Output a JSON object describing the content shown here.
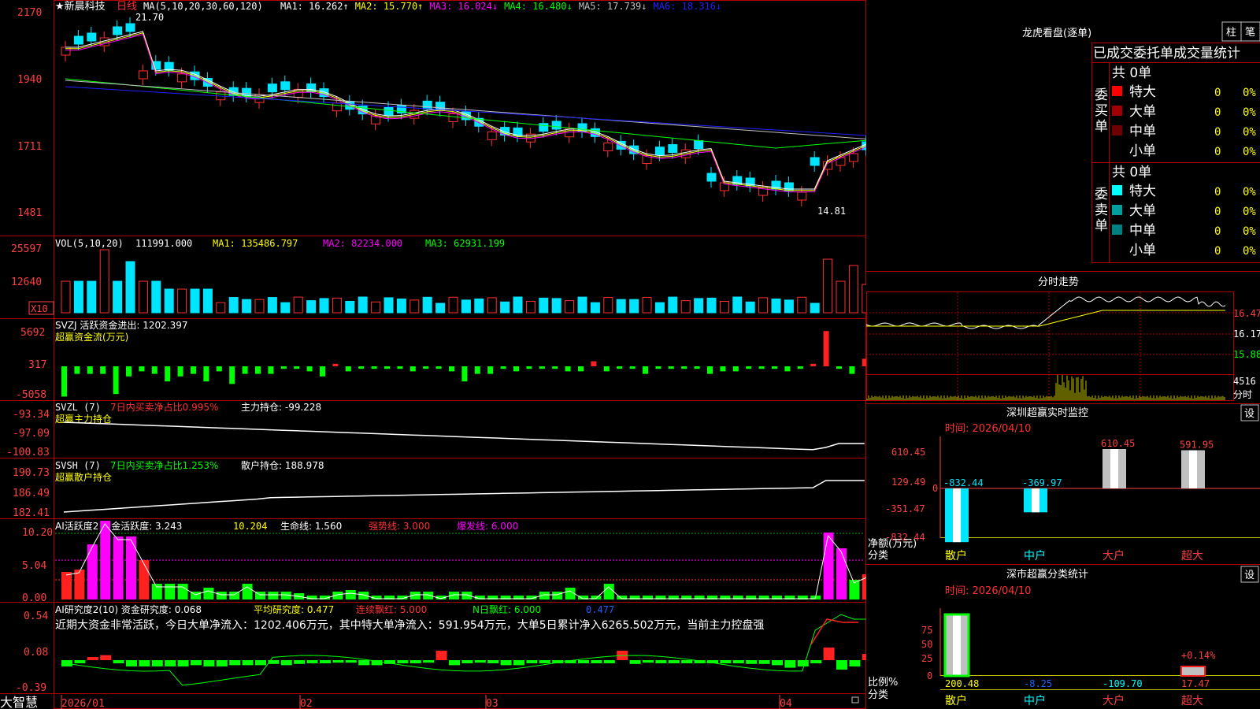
{
  "stock_name": "★新晨科技",
  "period": "日线",
  "ma_header": {
    "prefix": "MA(5,10,20,30,60,120)",
    "items": [
      {
        "label": "MA1: 16.262",
        "color": "#ffffff",
        "arrow": "↑"
      },
      {
        "label": "MA2: 15.770",
        "color": "#ffff00",
        "arrow": "↑"
      },
      {
        "label": "MA3: 16.024",
        "color": "#ff00ff",
        "arrow": "↓"
      },
      {
        "label": "MA4: 16.480",
        "color": "#00ff00",
        "arrow": "↓"
      },
      {
        "label": "MA5: 17.739",
        "color": "#c0c0c0",
        "arrow": "↓"
      },
      {
        "label": "MA6: 18.316",
        "color": "#2020ff",
        "arrow": "↓"
      }
    ]
  },
  "price_axis": [
    "2170",
    "1940",
    "1711",
    "1481"
  ],
  "price_high_label": "21.70",
  "price_low_label": "14.81",
  "vol_header": {
    "prefix": "VOL(5,10,20)",
    "value": "111991.000",
    "ma1": "MA1: 135486.797",
    "ma2": "MA2: 82234.000",
    "ma3": "MA3: 62931.199"
  },
  "vol_axis": [
    "25597",
    "12640"
  ],
  "vol_unit": "X10",
  "svzj": {
    "title": "SVZJ  活跃资金进出: 1202.397",
    "subtitle": "超赢资金流(万元)",
    "axis": [
      "5692",
      "317",
      "-5058"
    ],
    "values": [
      -12,
      -3,
      -3,
      -3,
      -11,
      -4,
      -2,
      -3,
      -6,
      -4,
      -3,
      -6,
      -2,
      -7,
      -3,
      -3,
      -3,
      -1,
      -1,
      -2,
      -4,
      1,
      -2,
      -1,
      -1,
      -1,
      -1,
      -2,
      -1,
      -1,
      -2,
      -6,
      -3,
      -3,
      -1,
      -2,
      -1,
      -1,
      -1,
      -2,
      -2,
      2,
      -2,
      -1,
      -1,
      -3,
      -1,
      -1,
      -1,
      -1,
      -3,
      -2,
      -2,
      -1,
      -1,
      -1,
      -2,
      -1,
      1,
      14,
      -1,
      -3,
      3
    ]
  },
  "svzl": {
    "title_a": "SVZL (7)",
    "title_b": "7日内买卖净占比0.995%",
    "title_c": "主力持仓: -99.228",
    "subtitle": "超赢主力持仓",
    "axis": [
      "-93.34",
      "-97.09",
      "-100.83"
    ]
  },
  "svsh": {
    "title_a": "SVSH (7)",
    "title_b": "7日内买卖净占比1.253%",
    "title_c": "散户持仓: 188.978",
    "subtitle": "超赢散户持仓",
    "axis": [
      "190.73",
      "186.49",
      "182.41"
    ]
  },
  "ai_active": {
    "title": "AI活跃度2 资金活跃度: 3.243",
    "v2": "10.204",
    "life": "生命线: 1.560",
    "strong": "强势线: 3.000",
    "burst": "爆发线: 6.000",
    "axis": [
      "10.20",
      "5.04",
      "0.00"
    ],
    "values": [
      3.5,
      3.8,
      7,
      10,
      8,
      8,
      5,
      2,
      2,
      2,
      1,
      1.5,
      1,
      1,
      2,
      1,
      1,
      1,
      0.8,
      0.5,
      0.5,
      1,
      1.2,
      1,
      0.5,
      0.5,
      0.5,
      1,
      1,
      0.5,
      1,
      1,
      0.5,
      0.5,
      0.5,
      0.5,
      0.5,
      1,
      1,
      1.5,
      0.5,
      0.5,
      2,
      0.5,
      0.5,
      0.5,
      0.5,
      0.5,
      0.5,
      0.5,
      0.5,
      0.5,
      0.5,
      0.5,
      0.5,
      0.5,
      0.5,
      0.5,
      0.5,
      8.5,
      6.5,
      2.5,
      3.2
    ]
  },
  "ai_research": {
    "title": "AI研究度2(10) 资金研究度: 0.068",
    "avg": "平均研究度: 0.477",
    "red": "连续飘红: 5.000",
    "nred": "N日飘红: 6.000",
    "last": "0.477",
    "text": "近期大资金非常活跃，今日大单净流入：1202.406万元，其中特大单净流入：591.954万元，大单5日累计净入6265.502万元，当前主力控盘强",
    "axis": [
      "0.54",
      "0.08",
      "-0.39"
    ],
    "values": [
      -1,
      -0.5,
      0.5,
      0.8,
      -0.5,
      -1,
      -1,
      -1,
      -1,
      -1,
      -0.8,
      -1,
      -1,
      -0.8,
      -0.8,
      -0.8,
      -0.6,
      -0.8,
      -0.6,
      -0.5,
      -0.5,
      -0.4,
      -0.4,
      -0.8,
      -0.8,
      -0.6,
      -0.5,
      -0.5,
      -0.4,
      1.5,
      -0.8,
      -0.5,
      -0.4,
      -0.5,
      -0.8,
      -0.8,
      -0.5,
      -0.5,
      -0.5,
      -0.5,
      -0.5,
      -0.5,
      -0.5,
      1.5,
      -0.6,
      -0.4,
      -0.5,
      -0.5,
      -0.5,
      -0.5,
      -0.5,
      -0.5,
      -0.5,
      -0.6,
      -0.6,
      -0.8,
      -1.2,
      -1,
      -0.5,
      2,
      -1.5,
      -1,
      1
    ]
  },
  "date_axis": [
    "2026/01",
    "02",
    "03",
    "04"
  ],
  "brand": "大智慧",
  "dragon_tiger": {
    "title": "龙虎看盘(逐单)",
    "tab_bar": "柱",
    "tab_pen": "笔",
    "subtitle": "已成交委托单成交量统计",
    "buy_label": "委买单",
    "sell_label": "委卖单",
    "buy_total": "共 0单",
    "sell_total": "共 0单",
    "buy_rows": [
      {
        "name": "特大",
        "count": "0",
        "pct": "0%",
        "color": "#ff0000"
      },
      {
        "name": "大单",
        "count": "0",
        "pct": "0%",
        "color": "#a00000"
      },
      {
        "name": "中单",
        "count": "0",
        "pct": "0%",
        "color": "#700000"
      },
      {
        "name": "小单",
        "count": "0",
        "pct": "0%",
        "color": "#000000"
      }
    ],
    "sell_rows": [
      {
        "name": "特大",
        "count": "0",
        "pct": "0%",
        "color": "#00ffff"
      },
      {
        "name": "大单",
        "count": "0",
        "pct": "0%",
        "color": "#00a0a0"
      },
      {
        "name": "中单",
        "count": "0",
        "pct": "0%",
        "color": "#008080"
      },
      {
        "name": "小单",
        "count": "0",
        "pct": "0%",
        "color": "#000000"
      }
    ]
  },
  "intraday": {
    "title": "分时走势",
    "axis": [
      "16.47",
      "16.17",
      "15.88"
    ],
    "vol_axis": [
      "4516",
      "分时"
    ]
  },
  "monitor": {
    "title": "深圳超赢实时监控",
    "setting": "设",
    "time": "时间: 2026/04/10",
    "axis": [
      "610.45",
      "129.49",
      "0",
      "-351.47",
      "-832.44"
    ],
    "axis_title": "净额(万元)",
    "cat_title": "分类",
    "categories": [
      "散户",
      "中户",
      "大户",
      "超大"
    ],
    "values": [
      -832.44,
      -369.97,
      610.45,
      591.95
    ],
    "labels": [
      "-832.44",
      "-369.97",
      "610.45",
      "591.95"
    ]
  },
  "classify": {
    "title": "深市超赢分类统计",
    "setting": "设",
    "time": "时间: 2026/04/10",
    "axis": [
      "75",
      "50",
      "25",
      "0"
    ],
    "axis_title": "比例%",
    "cat_title": "分类",
    "categories": [
      "散户",
      "中户",
      "大户",
      "超大"
    ],
    "values": [
      200.48,
      -8.25,
      -109.7,
      17.47
    ],
    "labels": [
      "200.48",
      "-8.25",
      "-109.70",
      "17.47"
    ],
    "top_label": "+0.14%"
  }
}
